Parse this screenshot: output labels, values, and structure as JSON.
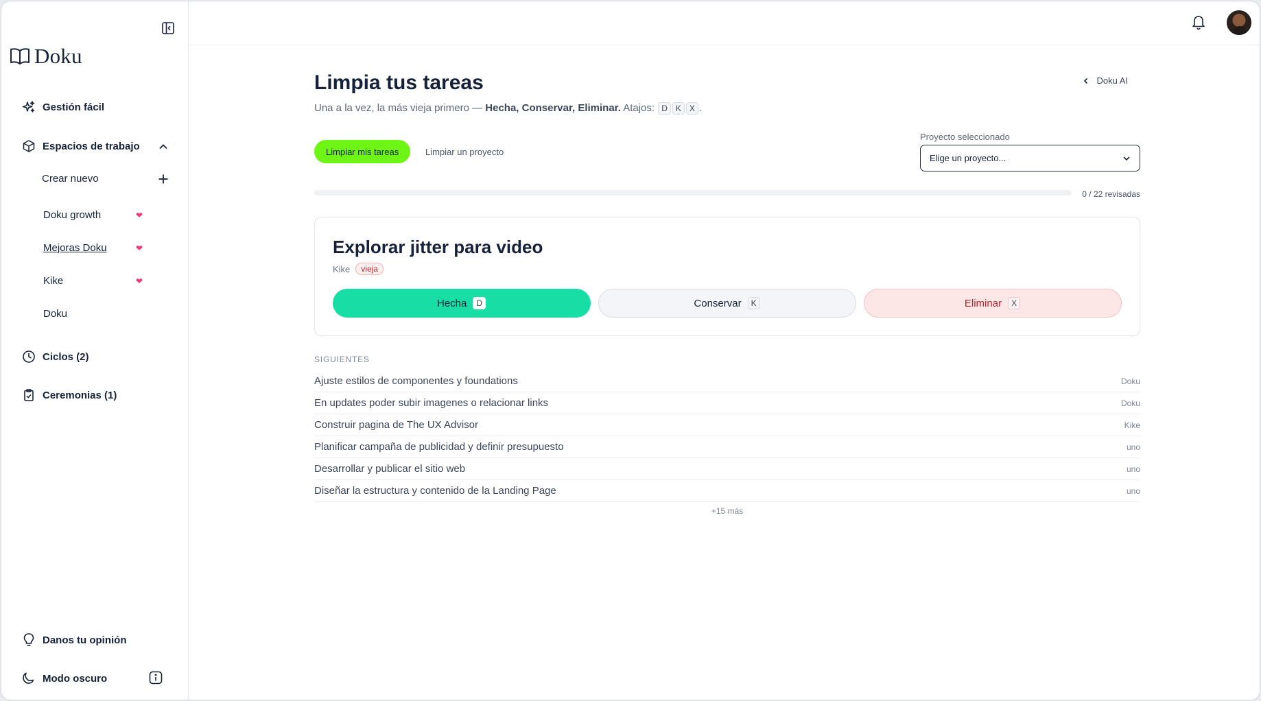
{
  "app": {
    "name": "Doku"
  },
  "sidebar": {
    "nav": {
      "gestion": "Gestión fácil",
      "espacios": "Espacios de trabajo",
      "crear_nuevo": "Crear nuevo",
      "ciclos": "Ciclos (2)",
      "ceremonias": "Ceremonias (1)"
    },
    "workspaces": [
      {
        "label": "Doku growth",
        "favorite": true
      },
      {
        "label": "Mejoras Doku",
        "favorite": true,
        "active": true
      },
      {
        "label": "Kike",
        "favorite": true
      },
      {
        "label": "Doku",
        "favorite": false
      }
    ],
    "bottom": {
      "feedback": "Danos tu opinión",
      "dark_mode": "Modo oscuro"
    }
  },
  "main": {
    "title": "Limpia tus tareas",
    "doku_ai": "Doku AI",
    "subtitle": {
      "prefix": "Una a la vez, la más vieja primero — ",
      "actions": "Hecha, Conservar, Eliminar.",
      "shortcuts_label": " Atajos: ",
      "keys": [
        "D",
        "K",
        "X"
      ],
      "suffix": "."
    },
    "primary_button": "Limpiar mis tareas",
    "secondary_button": "Limpiar un proyecto",
    "project_select": {
      "label": "Proyecto seleccionado",
      "value": "Elige un proyecto..."
    },
    "progress": {
      "reviewed": 0,
      "total": 22,
      "text": "0 / 22 revisadas"
    },
    "current_task": {
      "title": "Explorar jitter para video",
      "owner": "Kike",
      "tag": "vieja",
      "actions": [
        {
          "label": "Hecha",
          "key": "D"
        },
        {
          "label": "Conservar",
          "key": "K"
        },
        {
          "label": "Eliminar",
          "key": "X"
        }
      ]
    },
    "next_label": "SIGUIENTES",
    "next_tasks": [
      {
        "title": "Ajuste estilos de componentes y foundations",
        "project": "Doku"
      },
      {
        "title": "En updates poder subir imagenes o relacionar links",
        "project": "Doku"
      },
      {
        "title": "Construir pagina de The UX Advisor",
        "project": "Kike"
      },
      {
        "title": "Planificar campaña de publicidad y definir presupuesto",
        "project": "uno"
      },
      {
        "title": "Desarrollar y publicar el sitio web",
        "project": "uno"
      },
      {
        "title": "Diseñar la estructura y contenido de la Landing Page",
        "project": "uno"
      }
    ],
    "more": "+15 más"
  },
  "colors": {
    "accent": "#6ef516",
    "done": "#16dea5",
    "delete_bg": "#fde6e6",
    "heart": "#ec3b72",
    "text": "#16223a"
  },
  "icons": [
    "sidebar-collapse-icon",
    "book-icon",
    "sparkle-icon",
    "cube-icon",
    "chevron-up-icon",
    "plus-icon",
    "heart-icon",
    "clock-icon",
    "clipboard-icon",
    "bell-icon",
    "chevron-left-icon",
    "chevron-down-icon",
    "lightbulb-icon",
    "moon-icon",
    "info-icon"
  ]
}
